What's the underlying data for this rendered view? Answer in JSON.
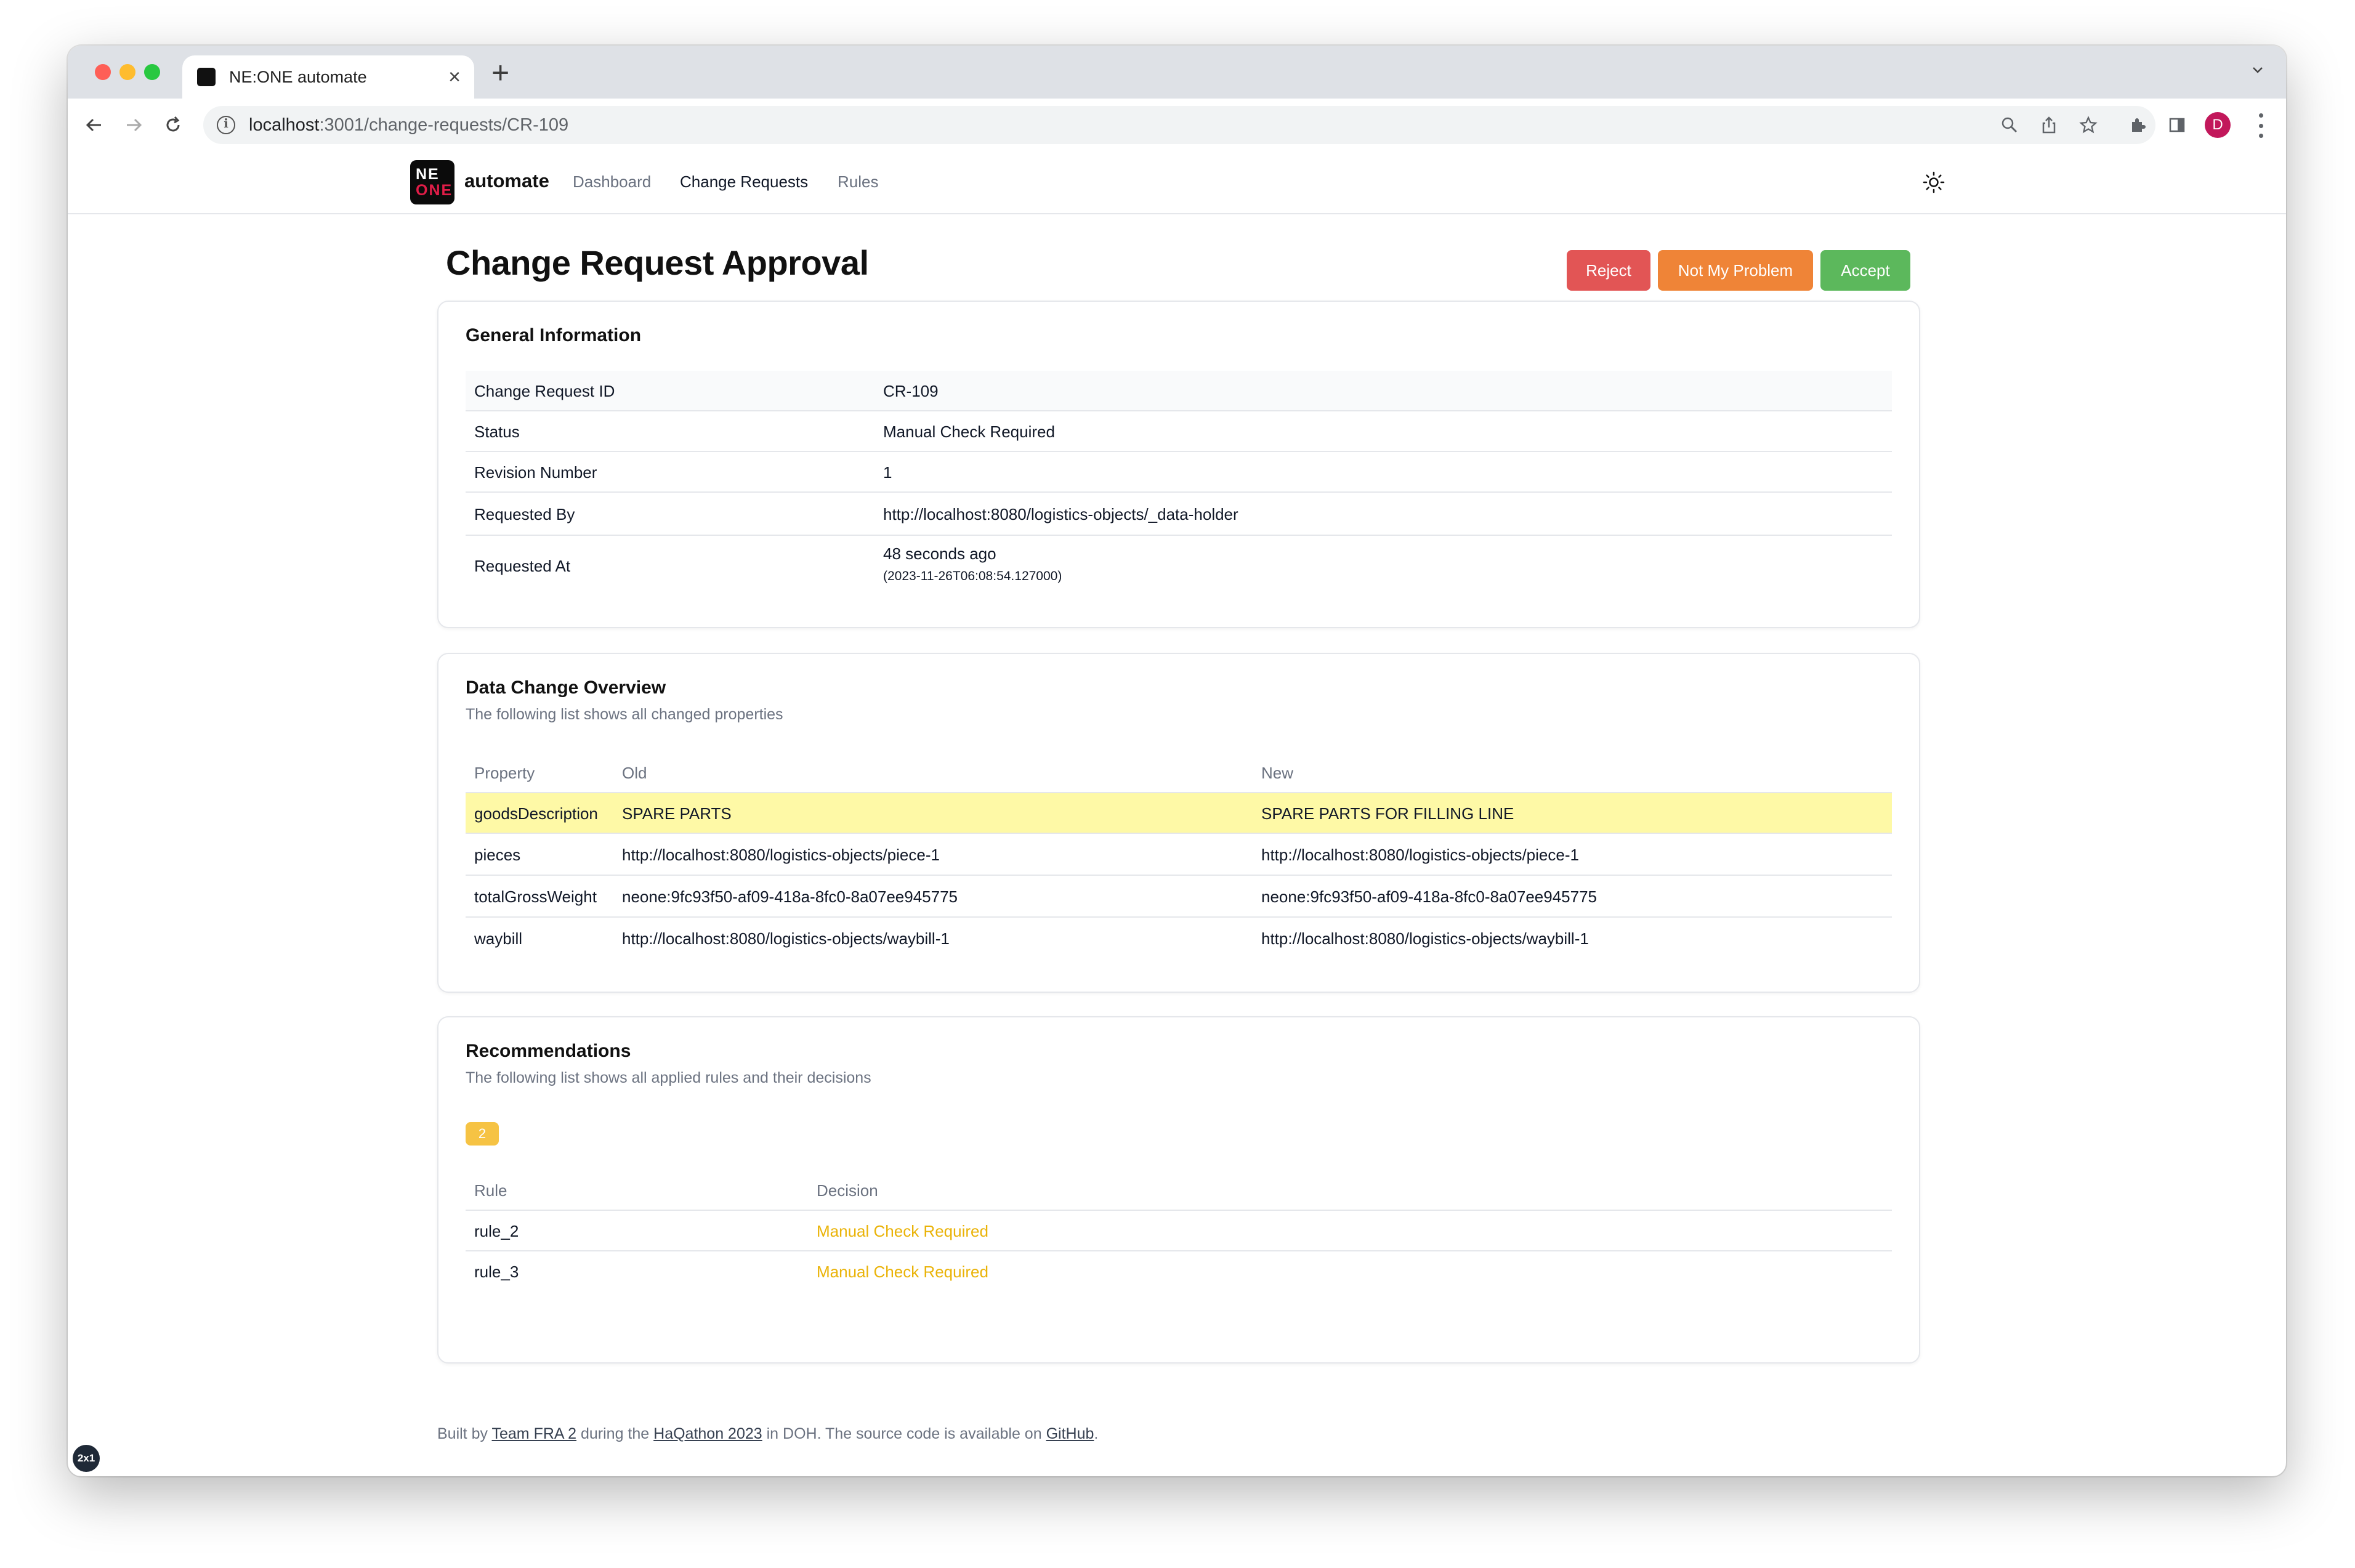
{
  "browser": {
    "tab_title": "NE:ONE automate",
    "url_host": "localhost",
    "url_path": ":3001/change-requests/CR-109",
    "profile_initial": "D"
  },
  "app": {
    "logo_top": "NE",
    "logo_bottom": "ONE",
    "brand": "automate",
    "nav": [
      "Dashboard",
      "Change Requests",
      "Rules"
    ]
  },
  "page": {
    "title": "Change Request Approval",
    "actions": {
      "reject": "Reject",
      "not_my_problem": "Not My Problem",
      "accept": "Accept"
    }
  },
  "general": {
    "title": "General Information",
    "rows": [
      {
        "label": "Change Request ID",
        "value": "CR-109"
      },
      {
        "label": "Status",
        "value": "Manual Check Required"
      },
      {
        "label": "Revision Number",
        "value": "1"
      },
      {
        "label": "Requested By",
        "value": "http://localhost:8080/logistics-objects/_data-holder"
      },
      {
        "label": "Requested At",
        "value": "48 seconds ago",
        "sub": "(2023-11-26T06:08:54.127000)"
      }
    ]
  },
  "data_change": {
    "title": "Data Change Overview",
    "subtitle": "The following list shows all changed properties",
    "headers": [
      "Property",
      "Old",
      "New"
    ],
    "rows": [
      {
        "property": "goodsDescription",
        "old": "SPARE PARTS",
        "new": "SPARE PARTS FOR FILLING LINE",
        "changed": true
      },
      {
        "property": "pieces",
        "old": "http://localhost:8080/logistics-objects/piece-1",
        "new": "http://localhost:8080/logistics-objects/piece-1",
        "changed": false
      },
      {
        "property": "totalGrossWeight",
        "old": "neone:9fc93f50-af09-418a-8fc0-8a07ee945775",
        "new": "neone:9fc93f50-af09-418a-8fc0-8a07ee945775",
        "changed": false
      },
      {
        "property": "waybill",
        "old": "http://localhost:8080/logistics-objects/waybill-1",
        "new": "http://localhost:8080/logistics-objects/waybill-1",
        "changed": false
      }
    ]
  },
  "recommendations": {
    "title": "Recommendations",
    "subtitle": "The following list shows all applied rules and their decisions",
    "badge": "2",
    "headers": [
      "Rule",
      "Decision"
    ],
    "rows": [
      {
        "rule": "rule_2",
        "decision": "Manual Check Required"
      },
      {
        "rule": "rule_3",
        "decision": "Manual Check Required"
      }
    ]
  },
  "footer": {
    "t1": "Built by ",
    "l1": "Team FRA 2",
    "t2": " during the ",
    "l2": "HaQathon 2023",
    "t3": " in DOH. The source code is available on ",
    "l3": "GitHub",
    "t4": "."
  },
  "overlay_badge": "2x1"
}
